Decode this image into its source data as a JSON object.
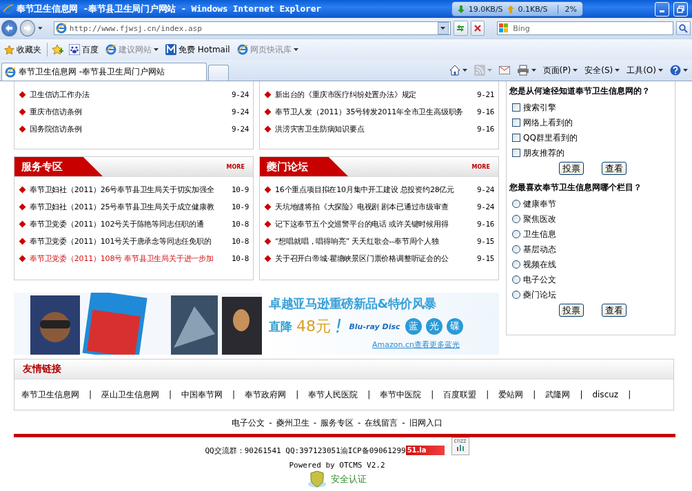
{
  "window": {
    "title": "奉节卫生信息网 -奉节县卫生局门户网站 - Windows Internet Explorer",
    "net_down": "19.0KB/S",
    "net_up": "0.1KB/S",
    "cpu": "2%"
  },
  "address_bar": {
    "url": "http://www.fjwsj.cn/index.asp",
    "search_placeholder": "Bing"
  },
  "favorites_bar": [
    {
      "label": "收藏夹",
      "kind": "favorites",
      "disabled": false,
      "dropdown": false
    },
    {
      "label": "百度",
      "kind": "paw",
      "disabled": false,
      "dropdown": false
    },
    {
      "label": "建议网站",
      "kind": "page",
      "disabled": true,
      "dropdown": true
    },
    {
      "label": "免费 Hotmail",
      "kind": "m",
      "disabled": false,
      "dropdown": false
    },
    {
      "label": "网页快讯库",
      "kind": "page",
      "disabled": true,
      "dropdown": true
    }
  ],
  "tab": {
    "title": "奉节卫生信息网 -奉节县卫生局门户网站"
  },
  "command_bar": [
    {
      "kind": "home",
      "disabled": false,
      "dropdown": true
    },
    {
      "kind": "feeds",
      "disabled": true,
      "dropdown": true
    },
    {
      "kind": "mail",
      "disabled": false,
      "dropdown": false
    },
    {
      "kind": "print",
      "disabled": false,
      "dropdown": true
    },
    {
      "kind": "text",
      "label": "页面(P)",
      "disabled": false,
      "dropdown": true
    },
    {
      "kind": "text",
      "label": "安全(S)",
      "disabled": false,
      "dropdown": true
    },
    {
      "kind": "text",
      "label": "工具(O)",
      "disabled": false,
      "dropdown": true
    },
    {
      "kind": "help",
      "disabled": false,
      "dropdown": true
    }
  ],
  "top_panels": [
    {
      "items": [
        {
          "title": "卫生信访工作办法",
          "date": "9-24",
          "highlighted": false
        },
        {
          "title": "重庆市信访条例",
          "date": "9-24",
          "highlighted": false
        },
        {
          "title": "国务院信访条例",
          "date": "9-24",
          "highlighted": false
        }
      ]
    },
    {
      "items": [
        {
          "title": "新出台的《重庆市医疗纠纷处置办法》规定",
          "date": "9-21",
          "highlighted": false
        },
        {
          "title": "奉节卫人发（2011）35号转发2011年全市卫生高级职务",
          "date": "9-16",
          "highlighted": false
        },
        {
          "title": "洪涝灾害卫生防病知识要点",
          "date": "9-16",
          "highlighted": false
        }
      ]
    }
  ],
  "sections": [
    {
      "title": "服务专区",
      "more": "MORE",
      "items": [
        {
          "title": "奉节卫妇社（2011）26号奉节县卫生局关于切实加强全",
          "date": "10-9",
          "highlighted": false
        },
        {
          "title": "奉节卫妇社（2011）25号奉节县卫生局关于成立健康教",
          "date": "10-9",
          "highlighted": false
        },
        {
          "title": "奉节卫党委（2011）102号关于陈艳等同志任职的通",
          "date": "10-8",
          "highlighted": false
        },
        {
          "title": "奉节卫党委（2011）101号关于唐承念等同志任免职的",
          "date": "10-8",
          "highlighted": false
        },
        {
          "title": "奉节卫党委（2011）108号 奉节县卫生局关于进一步加",
          "date": "10-8",
          "highlighted": true
        }
      ]
    },
    {
      "title": "夔门论坛",
      "more": "MORE",
      "items": [
        {
          "title": "16个重点项目拟在10月集中开工建设 总投资约28亿元",
          "date": "9-24",
          "highlighted": false
        },
        {
          "title": "天坑地缝将拍《大探险》电视剧 剧本已通过市级审查",
          "date": "9-24",
          "highlighted": false
        },
        {
          "title": "记下这奉节五个交巡警平台的电话 或许关键时候用得",
          "date": "9-16",
          "highlighted": false
        },
        {
          "title": "“想唱就唱，唱得响亮” 天天红歌会--奉节周个人独",
          "date": "9-15",
          "highlighted": false
        },
        {
          "title": "关于召开白帝城·瞿塘峡景区门票价格调整听证会的公",
          "date": "9-15",
          "highlighted": false
        }
      ]
    }
  ],
  "polls": [
    {
      "question": "您是从何途径知道奉节卫生信息网的？",
      "kind": "checkbox",
      "options": [
        {
          "label": "搜索引擎",
          "checked": false
        },
        {
          "label": "网络上看到的",
          "checked": false
        },
        {
          "label": "QQ群里看到的",
          "checked": false
        },
        {
          "label": "朋友推荐的",
          "checked": false
        }
      ],
      "buttons": [
        "投票",
        "查看"
      ]
    },
    {
      "question": "您最喜欢奉节卫生信息网哪个栏目？",
      "kind": "radio",
      "options": [
        {
          "label": "健康奉节",
          "checked": false
        },
        {
          "label": "聚焦医改",
          "checked": false
        },
        {
          "label": "卫生信息",
          "checked": false
        },
        {
          "label": "基层动态",
          "checked": false
        },
        {
          "label": "视频在线",
          "checked": false
        },
        {
          "label": "电子公文",
          "checked": false
        },
        {
          "label": "夔门论坛",
          "checked": false
        }
      ],
      "buttons": [
        "投票",
        "查看"
      ]
    }
  ],
  "banner": {
    "headline": "卓越亚马逊重磅新品&特价风暴",
    "discount_label": "直降",
    "discount_amount": "48元",
    "discount_mark": "!",
    "format_logo": "Blu-ray Disc",
    "format_chars": [
      "蓝",
      "光",
      "碟"
    ],
    "link": "Amazon.cn查看更多蓝光"
  },
  "friend_links": {
    "title": "友情链接",
    "separator": "|",
    "items": [
      "奉节卫生信息网",
      "巫山卫生信息网",
      "中国奉节网",
      "奉节政府网",
      "奉节人民医院",
      "奉节中医院",
      "百度联盟",
      "爱站网",
      "武隆网",
      "discuz"
    ]
  },
  "footer": {
    "separator": "-",
    "nav": [
      "电子公文",
      "夔州卫生",
      "服务专区",
      "在线留言",
      "旧网入口"
    ],
    "contact": "QQ交流群：90261541 QQ:397123051渝ICP备09061299",
    "stat_badge": "51.la",
    "stat_icon_label": "cnzz",
    "powered": "Powered by OTCMS V2.2",
    "security": "安全认证"
  }
}
